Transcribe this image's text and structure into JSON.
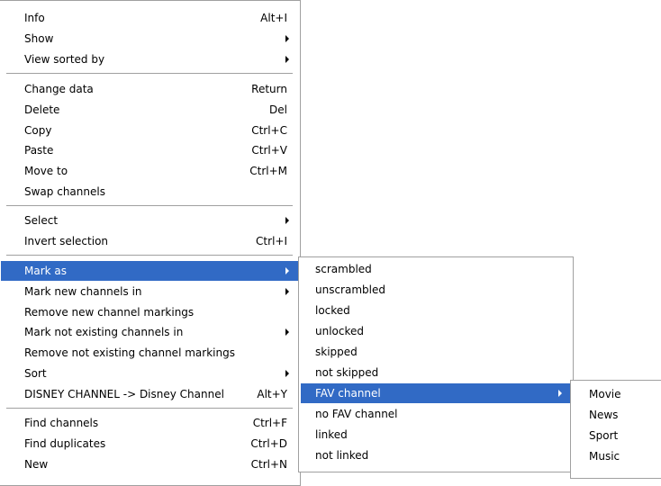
{
  "colors": {
    "highlight": "#316ac5",
    "highlight_text": "#ffffff",
    "menu_bg": "#ffffff",
    "border": "#a0a0a0"
  },
  "main_menu": {
    "info": {
      "label": "Info",
      "shortcut": "Alt+I"
    },
    "show": {
      "label": "Show"
    },
    "view_sorted_by": {
      "label": "View sorted by"
    },
    "change_data": {
      "label": "Change data",
      "shortcut": "Return"
    },
    "delete": {
      "label": "Delete",
      "shortcut": "Del"
    },
    "copy": {
      "label": "Copy",
      "shortcut": "Ctrl+C"
    },
    "paste": {
      "label": "Paste",
      "shortcut": "Ctrl+V"
    },
    "move_to": {
      "label": "Move to",
      "shortcut": "Ctrl+M"
    },
    "swap_channels": {
      "label": "Swap channels"
    },
    "select": {
      "label": "Select"
    },
    "invert_selection": {
      "label": "Invert selection",
      "shortcut": "Ctrl+I"
    },
    "mark_as": {
      "label": "Mark as"
    },
    "mark_new_channels_in": {
      "label": "Mark new channels in"
    },
    "remove_new_channel_markings": {
      "label": "Remove new channel markings"
    },
    "mark_not_existing_channels_in": {
      "label": "Mark not existing channels in"
    },
    "remove_not_existing_channel_markings": {
      "label": "Remove not existing channel markings"
    },
    "sort": {
      "label": "Sort"
    },
    "disney_rename": {
      "label": "DISNEY CHANNEL -> Disney Channel",
      "shortcut": "Alt+Y"
    },
    "find_channels": {
      "label": "Find channels",
      "shortcut": "Ctrl+F"
    },
    "find_duplicates": {
      "label": "Find duplicates",
      "shortcut": "Ctrl+D"
    },
    "new": {
      "label": "New",
      "shortcut": "Ctrl+N"
    }
  },
  "mark_as_menu": {
    "scrambled": "scrambled",
    "unscrambled": "unscrambled",
    "locked": "locked",
    "unlocked": "unlocked",
    "skipped": "skipped",
    "not_skipped": "not skipped",
    "fav_channel": "FAV channel",
    "no_fav_channel": "no FAV channel",
    "linked": "linked",
    "not_linked": "not linked"
  },
  "fav_menu": {
    "movie": "Movie",
    "news": "News",
    "sport": "Sport",
    "music": "Music"
  }
}
